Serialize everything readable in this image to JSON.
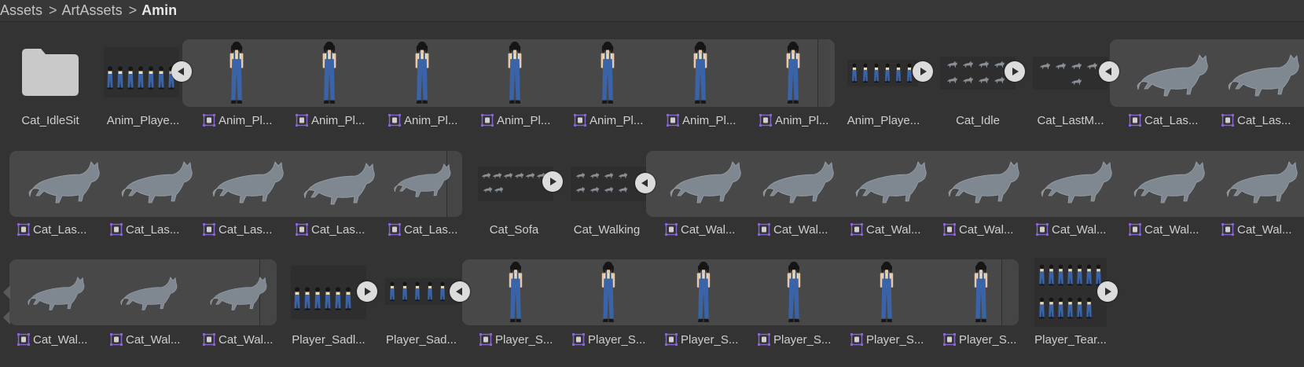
{
  "breadcrumb": {
    "root": "Assets",
    "middle": "ArtAssets",
    "current": "Amin"
  },
  "colors": {
    "background": "#333333",
    "group": "#484848",
    "icon_accent": "#8a63d2",
    "girl_overalls": "#3a63a8",
    "cat": "#7f8890"
  },
  "row1": {
    "folder": {
      "label": "Cat_IdleSit"
    },
    "anim1": {
      "label": "Anim_Playe..."
    },
    "sprites_label": "Anim_Pl...",
    "anim2": {
      "label": "Anim_Playe..."
    },
    "cat_idle": {
      "label": "Cat_Idle"
    },
    "cat_lastm": {
      "label": "Cat_LastM..."
    },
    "cat_las_label": "Cat_Las..."
  },
  "row2": {
    "cat_las_label": "Cat_Las...",
    "cat_sofa": {
      "label": "Cat_Sofa"
    },
    "cat_walking": {
      "label": "Cat_Walking"
    },
    "cat_wal_label": "Cat_Wal..."
  },
  "row3": {
    "cat_wal_label": "Cat_Wal...",
    "player_sadl": {
      "label": "Player_Sadl..."
    },
    "player_sad": {
      "label": "Player_Sad..."
    },
    "player_s_label": "Player_S...",
    "player_tear": {
      "label": "Player_Tear..."
    }
  },
  "icons": {
    "folder": "folder-icon",
    "play": "play-icon",
    "collapse": "collapse-icon",
    "sprite": "sprite-icon"
  }
}
